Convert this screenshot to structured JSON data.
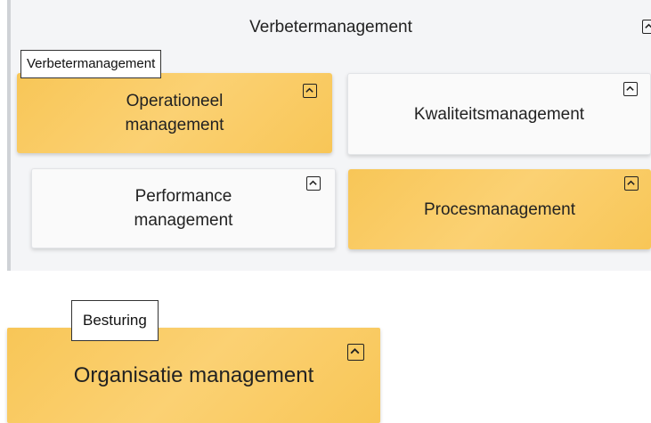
{
  "panel": {
    "title": "Verbetermanagement",
    "tooltip": "Verbetermanagement"
  },
  "tiles": [
    {
      "label_line1": "Operationeel",
      "label_line2": "management",
      "style": "orange"
    },
    {
      "label_line1": "Kwaliteitsmanagement",
      "label_line2": "",
      "style": "white"
    },
    {
      "label_line1": "Performance",
      "label_line2": "management",
      "style": "white"
    },
    {
      "label_line1": "Procesmanagement",
      "label_line2": "",
      "style": "orange"
    }
  ],
  "besturing": {
    "tooltip": "Besturing",
    "tile_label": "Organisatie management"
  },
  "icons": {
    "collapse": "chevron-up-icon"
  },
  "colors": {
    "accent_orange": "#f8c657",
    "tile_white": "#fafafa",
    "panel_bg": "#f4f5f7"
  }
}
